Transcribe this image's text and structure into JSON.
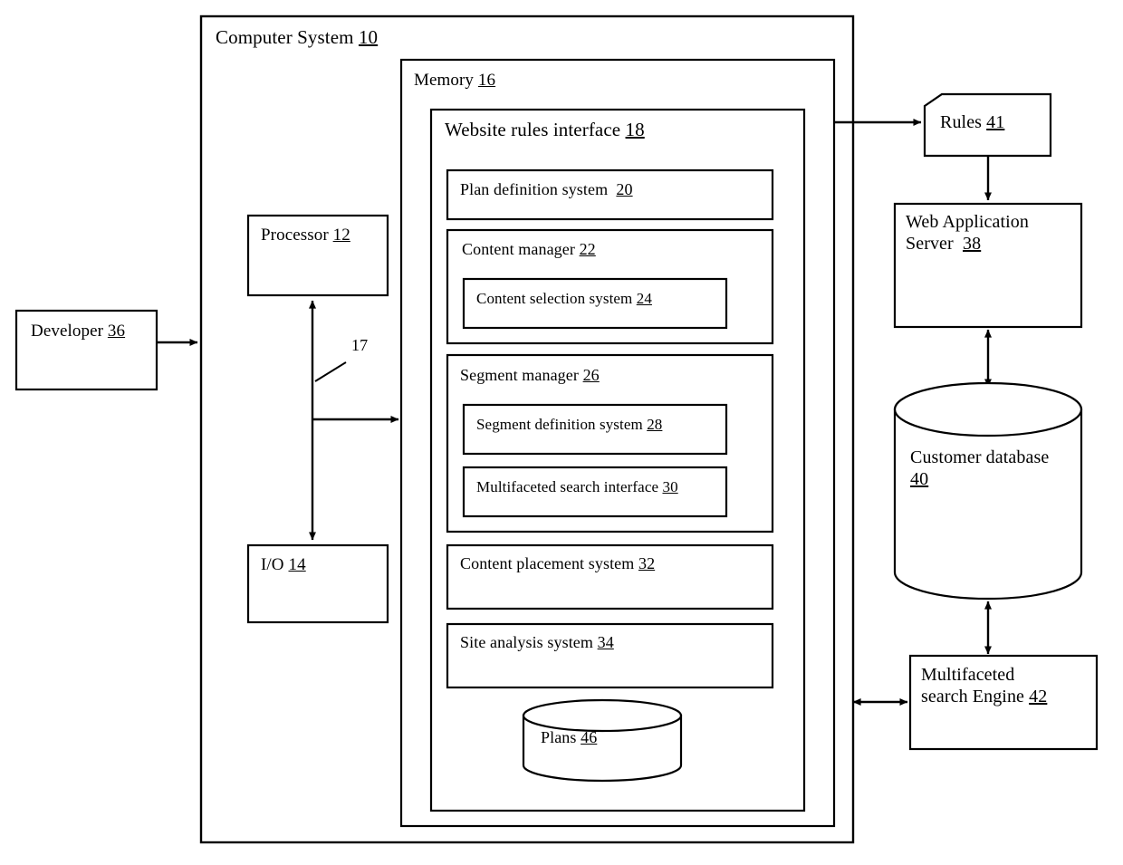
{
  "figure": {
    "kind": "patent-system-block-diagram",
    "background_color": "#ffffff",
    "line_color": "#000000"
  },
  "containers": {
    "computer_system": {
      "label": "Computer System",
      "ref": "10"
    },
    "memory": {
      "label": "Memory",
      "ref": "16"
    },
    "website_rules_interface": {
      "label": "Website rules interface",
      "ref": "18"
    }
  },
  "memory_modules": [
    {
      "label": "Plan definition system",
      "ref": "20"
    },
    {
      "label": "Content manager",
      "ref": "22"
    },
    {
      "label": "Content selection system",
      "ref": "24"
    },
    {
      "label": "Segment manager",
      "ref": "26"
    },
    {
      "label": "Segment definition system",
      "ref": "28"
    },
    {
      "label": "Multifaceted search interface",
      "ref": "30"
    },
    {
      "label": "Content placement system",
      "ref": "32"
    },
    {
      "label": "Site analysis system",
      "ref": "34"
    }
  ],
  "datastores": [
    {
      "label": "Plans",
      "ref": "46",
      "shape": "cylinder"
    },
    {
      "label": "Customer database",
      "ref": "40",
      "shape": "cylinder"
    }
  ],
  "hardware": [
    {
      "label": "Processor",
      "ref": "12"
    },
    {
      "label": "I/O",
      "ref": "14"
    }
  ],
  "external": [
    {
      "label": "Developer",
      "ref": "36"
    },
    {
      "label": "Rules",
      "ref": "41",
      "shape": "document"
    },
    {
      "label": "Web Application",
      "label_line2": "Server",
      "ref": "38"
    },
    {
      "label": "Multifaceted",
      "label_line2": "search Engine",
      "ref": "42"
    }
  ],
  "bus": {
    "ref": "17"
  }
}
